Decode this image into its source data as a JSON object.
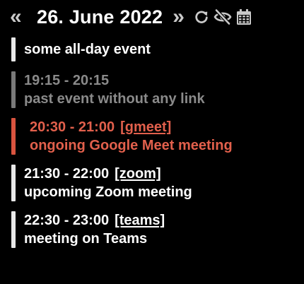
{
  "header": {
    "prev_label": "«",
    "date_title": "26. June 2022",
    "next_label": "»",
    "icons": [
      "refresh-icon",
      "eye-off-icon",
      "calendar-icon"
    ]
  },
  "events": [
    {
      "state": "normal",
      "time": "",
      "link": "",
      "title": "some all-day event"
    },
    {
      "state": "past",
      "time": "19:15 - 20:15",
      "link": "",
      "title": "past event without any link"
    },
    {
      "state": "ongoing",
      "time": "20:30 - 21:00",
      "link": "[gmeet]",
      "title": "ongoing Google Meet meeting"
    },
    {
      "state": "normal",
      "time": "21:30 - 22:00",
      "link": "[zoom]",
      "title": "upcoming Zoom meeting"
    },
    {
      "state": "normal",
      "time": "22:30 - 23:00",
      "link": "[teams]",
      "title": "meeting on Teams"
    }
  ],
  "colors": {
    "background": "#000000",
    "normal_text": "#ffffff",
    "past_text": "#8a8a8a",
    "ongoing_text": "#e2604c"
  }
}
